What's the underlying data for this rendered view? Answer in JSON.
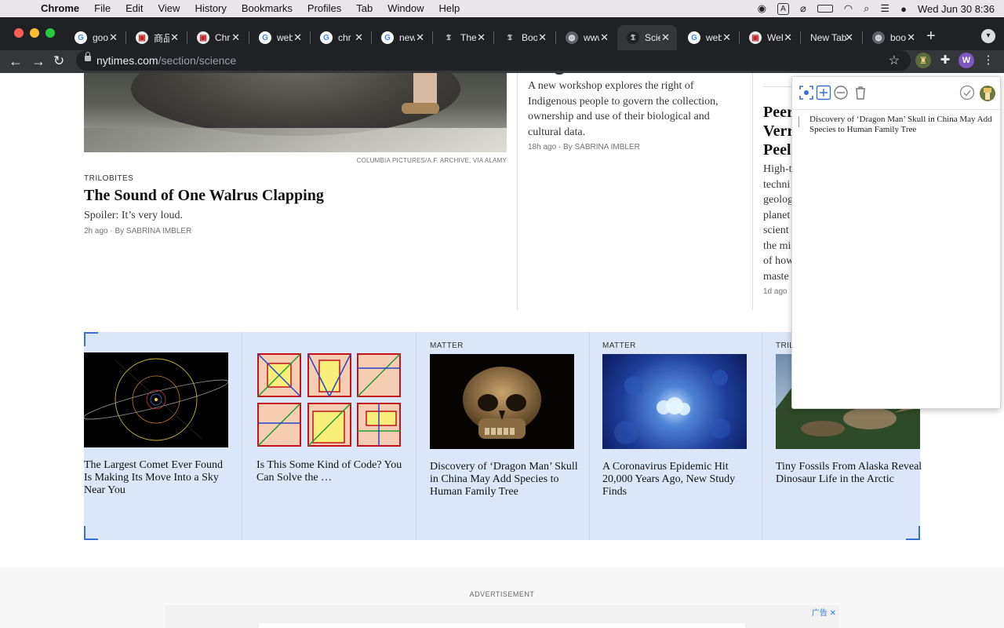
{
  "menubar": {
    "app": "Chrome",
    "items": [
      "File",
      "Edit",
      "View",
      "History",
      "Bookmarks",
      "Profiles",
      "Tab",
      "Window",
      "Help"
    ],
    "clock": "Wed Jun 30  8:36"
  },
  "tabs": [
    {
      "label": "goo",
      "icon": "google-icon"
    },
    {
      "label": "商品",
      "icon": "store-icon"
    },
    {
      "label": "Chr",
      "icon": "store-icon"
    },
    {
      "label": "web",
      "icon": "google-icon"
    },
    {
      "label": "chr",
      "icon": "google-icon"
    },
    {
      "label": "new",
      "icon": "google-icon"
    },
    {
      "label": "The",
      "icon": "nyt-icon"
    },
    {
      "label": "Boo",
      "icon": "nyt-icon"
    },
    {
      "label": "www",
      "icon": "globe-icon"
    },
    {
      "label": "Scie",
      "icon": "nyt-icon",
      "active": true
    },
    {
      "label": "web",
      "icon": "google-icon"
    },
    {
      "label": "WeE",
      "icon": "store-icon"
    },
    {
      "label": "New Tab",
      "icon": "none"
    },
    {
      "label": "boo",
      "icon": "globe-icon"
    }
  ],
  "omnibox": {
    "domain": "nytimes.com",
    "path": "/section/science"
  },
  "profile_initial": "W",
  "article_main": {
    "credit": "COLUMBIA PICTURES/A.F. ARCHIVE, VIA ALAMY",
    "kicker": "TRILOBITES",
    "headline": "The Sound of One Walrus Clapping",
    "summary": "Spoiler: It’s very loud.",
    "time": "2h ago",
    "byline": "By SABRINA IMBLER"
  },
  "article_mid": {
    "summary": "A new workshop explores the right of Indigenous people to govern the collection, ownership and use of their biological and cultural data.",
    "time": "18h ago",
    "byline": "By SABRINA IMBLER"
  },
  "article_right": {
    "headline_lines": [
      "Peer",
      "Verr",
      "Peel"
    ],
    "summary_lines": [
      "High-t",
      "techni",
      "geolog",
      "planet",
      "scient",
      "the mi",
      "of how",
      "maste"
    ],
    "time": "1d ago"
  },
  "strip": [
    {
      "kicker": "",
      "title": "The Largest Comet Ever Found Is Making Its Move Into a Sky Near You"
    },
    {
      "kicker": "",
      "title": "Is This Some Kind of Code? You Can Solve the …"
    },
    {
      "kicker": "MATTER",
      "title": "Discovery of ‘Dragon Man’ Skull in China May Add Species to Human Family Tree"
    },
    {
      "kicker": "MATTER",
      "title": "A Coronavirus Epidemic Hit 20,000 Years Ago, New Study Finds"
    },
    {
      "kicker": "TRILOBITES",
      "title": "Tiny Fossils From Alaska Reveal Dinosaur Life in the Arctic"
    }
  ],
  "ad": {
    "label": "ADVERTISEMENT",
    "tag": "广告"
  },
  "popup": {
    "note": "Discovery of ‘Dragon Man’ Skull in China May Add Species to Human Family Tree"
  },
  "colors": {
    "highlight": "#dbe6f8",
    "accent": "#3571d6"
  }
}
